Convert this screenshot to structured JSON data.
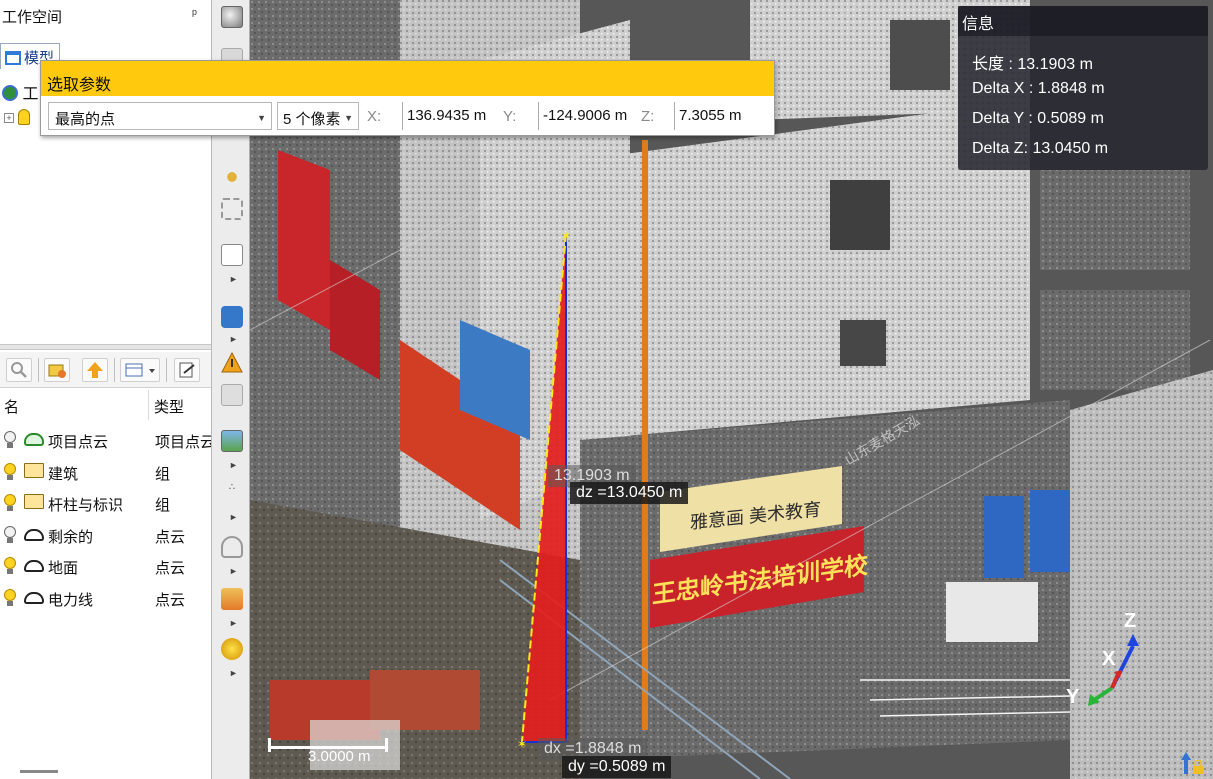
{
  "workspace": {
    "title": "工作空间",
    "pin_icon": "pin-icon",
    "tab_label": "模型",
    "tree_root_label": "工",
    "tree_child_label": "-"
  },
  "layers": {
    "col_name": "名",
    "col_type": "类型",
    "rows": [
      {
        "name": "项目点云",
        "type": "项目点云",
        "visible": false,
        "kind": "project-cloud"
      },
      {
        "name": "建筑",
        "type": "组",
        "visible": true,
        "kind": "folder"
      },
      {
        "name": "杆柱与标识",
        "type": "组",
        "visible": true,
        "kind": "folder"
      },
      {
        "name": "剩余的",
        "type": "点云",
        "visible": false,
        "kind": "cloud"
      },
      {
        "name": "地面",
        "type": "点云",
        "visible": true,
        "kind": "cloud"
      },
      {
        "name": "电力线",
        "type": "点云",
        "visible": true,
        "kind": "cloud"
      }
    ]
  },
  "pick_dialog": {
    "title": "选取参数",
    "mode": "最高的点",
    "radius": "5 个像素",
    "x_label": "X:",
    "x_value": "136.9435 m",
    "y_label": "Y:",
    "y_value": "-124.9006 m",
    "z_label": "Z:",
    "z_value": "7.3055 m"
  },
  "info_panel": {
    "title": "信息",
    "length": "长度 : 13.1903 m",
    "delta_x": "Delta X : 1.8848 m",
    "delta_y": "Delta Y : 0.5089 m",
    "delta_z": "Delta Z: 13.0450 m"
  },
  "measurement": {
    "length_label": "13.1903 m",
    "dz_label": "dz =13.0450 m",
    "dx_label": "dx =1.8848 m",
    "dy_label": "dy =0.5089 m"
  },
  "scale": {
    "label": "3.0000 m"
  },
  "axes": {
    "x": "X",
    "y": "Y",
    "z": "Z"
  },
  "scene_text": {
    "school_sign": "王忠岭书法培训学校",
    "art_sign": "雅意画 美术教育",
    "watermark": "山东麦格天泓"
  },
  "colors": {
    "dialog_title_bg": "#ffc90e",
    "measure_triangle": "#e41e1e",
    "measure_vertical": "#1a2fd0",
    "measure_hyp": "#ffe81a"
  }
}
